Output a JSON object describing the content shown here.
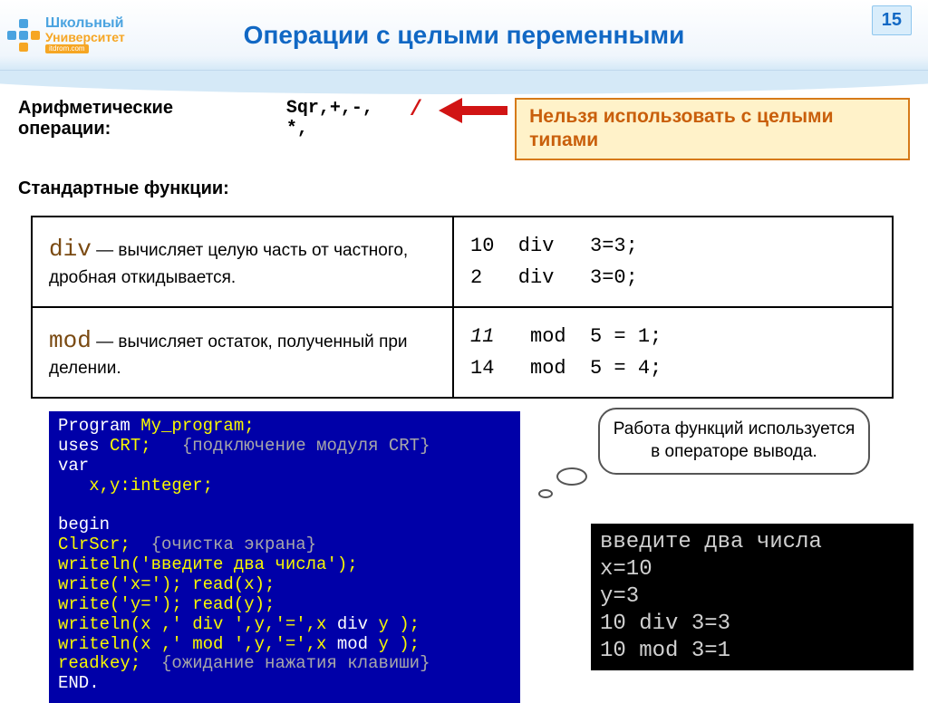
{
  "header": {
    "logo_top": "Школьный",
    "logo_bottom": "Университет",
    "logo_sub": "itdrom.com",
    "title": "Операции с целыми переменными",
    "page": "15"
  },
  "arith": {
    "label": "Арифметические операции:",
    "ops": "Sqr,+,-, *,",
    "op_forbidden": "/"
  },
  "callout": "Нельзя использовать с целыми типами",
  "std_label": "Стандартные функции:",
  "table": {
    "div_kw": "div",
    "div_desc": " — вычисляет целую часть от частного, дробная откидывается.",
    "div_ex": "10  div   3=3;\n2   div   3=0;",
    "mod_kw": "mod",
    "mod_desc": " — вычисляет остаток, полученный при делении.",
    "mod_ex_a": "11",
    "mod_ex_rest": "   mod  5 = 1;\n14   mod  5 = 4;"
  },
  "code": {
    "l1a": "Program ",
    "l1b": "My_program;",
    "l2a": "uses ",
    "l2b": "CRT;   ",
    "l2c": "{подключение модуля CRT}",
    "l3": "var",
    "l4": "   x,y:integer;",
    "l5": "begin",
    "l6a": "ClrScr;  ",
    "l6b": "{очистка экрана}",
    "l7": "writeln('введите два числа');",
    "l8": "write('x='); read(x);",
    "l9": "write('y='); read(y);",
    "l10a": "writeln(x ,' div ',y,'=',x ",
    "l10b": "div",
    "l10c": " y );",
    "l11a": "writeln(x ,' mod ',y,'=',x ",
    "l11b": "mod",
    "l11c": " y );",
    "l12a": "readkey;  ",
    "l12b": "{ожидание нажатия клавиши}",
    "l13": "END."
  },
  "bubble": "Работа функций используется в операторе вывода.",
  "output": "введите два числа\nx=10\ny=3\n10 div 3=3\n10 mod 3=1"
}
